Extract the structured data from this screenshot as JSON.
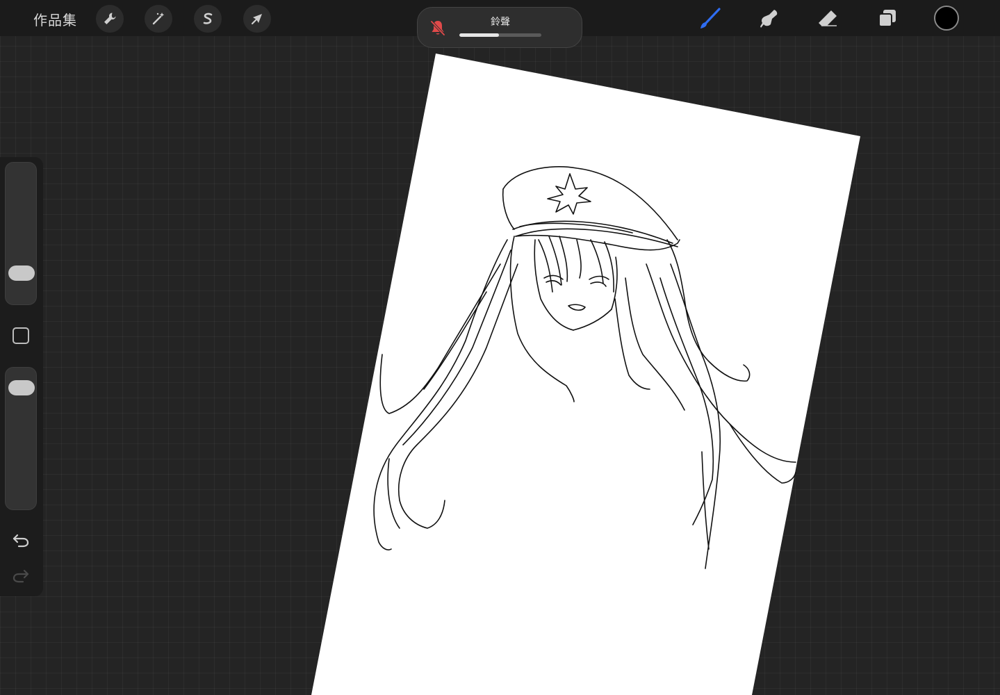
{
  "topbar": {
    "gallery_label": "作品集",
    "tools_left": [
      {
        "name": "actions",
        "icon": "wrench-icon"
      },
      {
        "name": "adjustments",
        "icon": "magic-wand-icon"
      },
      {
        "name": "selection",
        "icon": "selection-s-icon"
      },
      {
        "name": "transform",
        "icon": "arrow-cursor-icon"
      }
    ],
    "tools_right": [
      {
        "name": "brush",
        "icon": "brush-icon",
        "active": true
      },
      {
        "name": "smudge",
        "icon": "smudge-icon"
      },
      {
        "name": "eraser",
        "icon": "eraser-icon"
      },
      {
        "name": "layers",
        "icon": "layers-icon"
      }
    ],
    "current_color": "#000000",
    "active_color": "#2f6df2"
  },
  "hud": {
    "label": "鈴聲",
    "icon": "bell-muted-icon",
    "volume": 0.48,
    "bell_color": "#e04a4a"
  },
  "sidebar": {
    "brush_size": 0.18,
    "opacity": 0.92,
    "modify_icon": "square-icon",
    "undo_icon": "undo-icon",
    "redo_icon": "redo-icon"
  },
  "canvas": {
    "paper_color": "#ffffff",
    "ink_color": "#111111"
  }
}
